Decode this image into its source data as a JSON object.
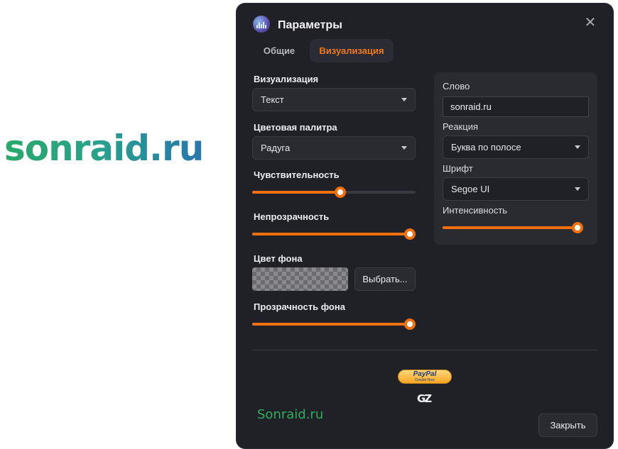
{
  "background_logo": "sonraid.ru",
  "window": {
    "title": "Параметры",
    "tabs": [
      {
        "label": "Общие",
        "active": false
      },
      {
        "label": "Визуализация",
        "active": true
      }
    ]
  },
  "left": {
    "visualization_label": "Визуализация",
    "visualization_value": "Текст",
    "palette_label": "Цветовая палитра",
    "palette_value": "Радуга",
    "sensitivity_label": "Чувствительность",
    "sensitivity_value": 0.54,
    "opacity_label": "Непрозрачность",
    "opacity_value": 1.0,
    "bg_color_label": "Цвет фона",
    "choose_button": "Выбрать...",
    "bg_transparency_label": "Прозрачность фона",
    "bg_transparency_value": 1.0
  },
  "right": {
    "word_label": "Слово",
    "word_value": "sonraid.ru",
    "reaction_label": "Реакция",
    "reaction_value": "Буква по полосе",
    "font_label": "Шрифт",
    "font_value": "Segoe UI",
    "intensity_label": "Интенсивность",
    "intensity_value": 1.0
  },
  "footer": {
    "paypal_word": "PayPal",
    "paypal_sub": "Donate Now",
    "gz_logo": "GZ",
    "site_link": "Sonraid.ru",
    "close_button": "Закрыть"
  },
  "colors": {
    "accent": "#f06f0e",
    "active_tab_text": "#ee7a22",
    "window_bg": "#202027",
    "panel_bg": "#2a2a31",
    "site_link": "#2fae62"
  }
}
